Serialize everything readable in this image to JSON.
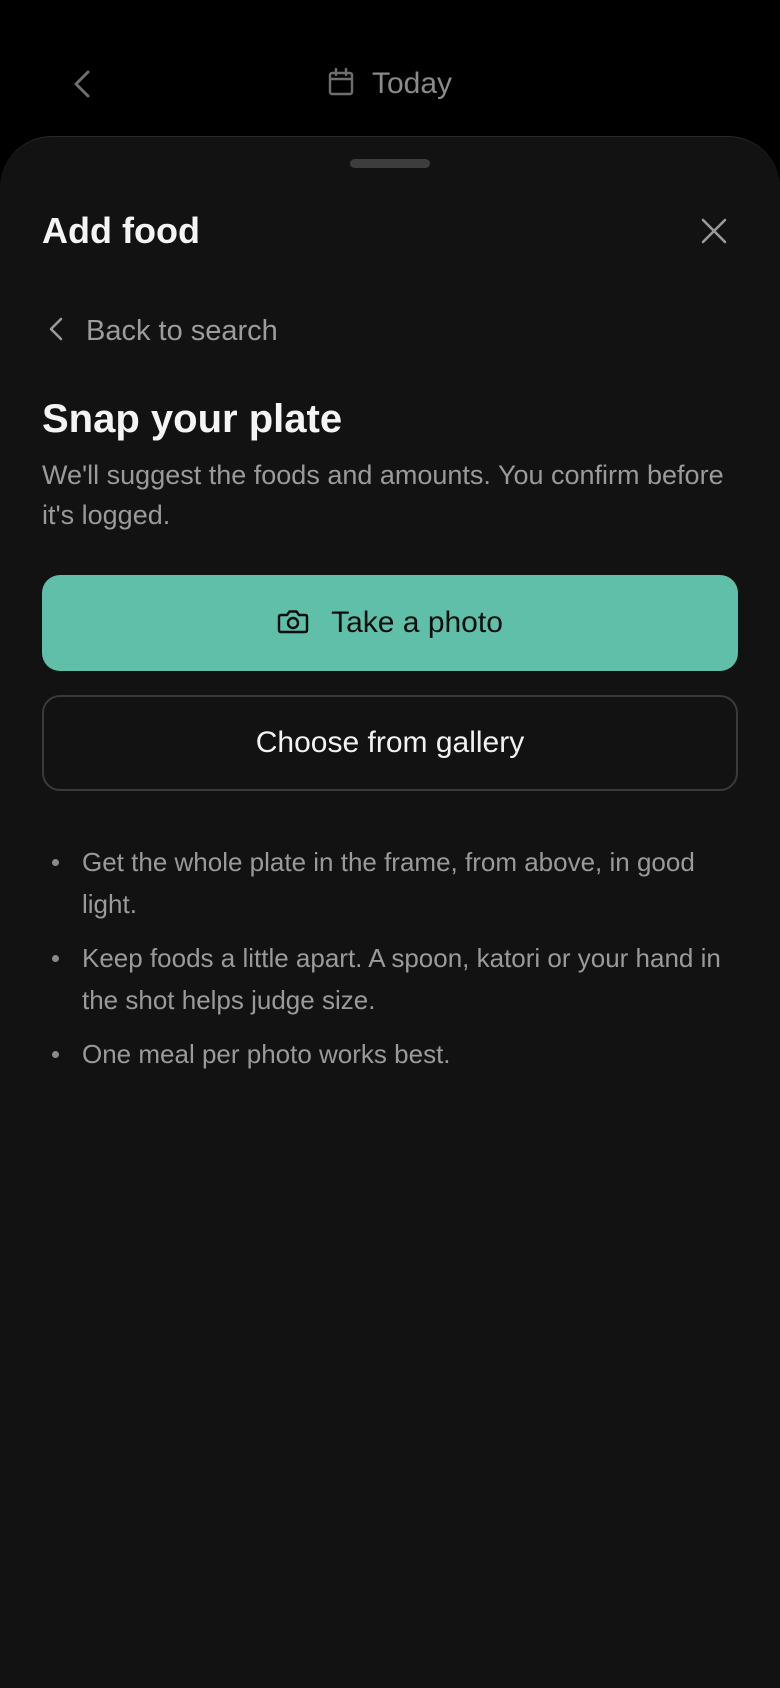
{
  "header": {
    "back_icon": "chevron-left-icon",
    "date_icon": "calendar-icon",
    "date_label": "Today"
  },
  "sheet": {
    "title": "Add food",
    "close_icon": "close-icon",
    "back_link": {
      "icon": "chevron-left-icon",
      "label": "Back to search"
    },
    "heading": "Snap your plate",
    "subtext": "We'll suggest the foods and amounts. You confirm before it's logged.",
    "primary_button": {
      "icon": "camera-icon",
      "label": "Take a photo"
    },
    "secondary_button": {
      "label": "Choose from gallery"
    },
    "tips": [
      "Get the whole plate in the frame, from above, in good light.",
      "Keep foods a little apart. A spoon, katori or your hand in the shot helps judge size.",
      "One meal per photo works best."
    ]
  },
  "colors": {
    "background": "#000000",
    "sheet": "#121212",
    "accent": "#5fbfa8",
    "text_primary": "#f4f4f4",
    "text_secondary": "#9a9a9a"
  }
}
